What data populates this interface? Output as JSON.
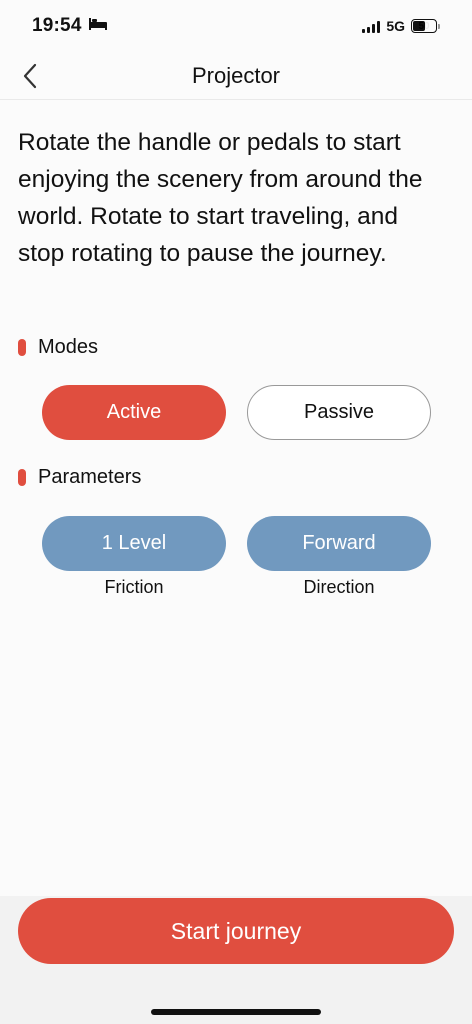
{
  "status_bar": {
    "time": "19:54",
    "network": "5G",
    "battery": "50",
    "sleep_icon": "bed-icon"
  },
  "nav": {
    "title": "Projector",
    "back_icon": "chevron-left-icon"
  },
  "intro_text": "Rotate the handle or pedals to start enjoying the scenery from around the world. Rotate to start traveling, and stop rotating to pause the journey.",
  "modes": {
    "label": "Modes",
    "options": [
      {
        "label": "Active",
        "selected": true
      },
      {
        "label": "Passive",
        "selected": false
      }
    ]
  },
  "parameters": {
    "label": "Parameters",
    "items": [
      {
        "value": "1 Level",
        "caption": "Friction"
      },
      {
        "value": "Forward",
        "caption": "Direction"
      }
    ]
  },
  "start_button": {
    "label": "Start journey"
  },
  "colors": {
    "accent": "#e04e3f",
    "parameter_pill": "#7199bf"
  }
}
